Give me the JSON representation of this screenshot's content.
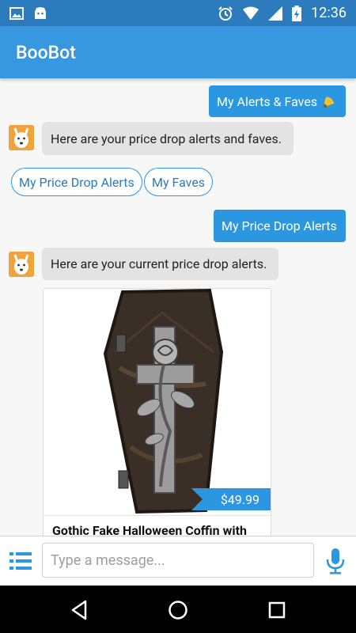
{
  "status_bar": {
    "time": "12:36",
    "left_icons": [
      "image-icon",
      "android-icon"
    ],
    "right_icons": [
      "alarm-icon",
      "wifi-icon",
      "signal-icon",
      "battery-icon"
    ]
  },
  "app_bar": {
    "title": "BooBot"
  },
  "chat": {
    "messages": [
      {
        "from": "user",
        "text": "My Alerts & Faves"
      },
      {
        "from": "bot",
        "text": "Here are your price drop alerts and faves."
      },
      {
        "from": "user",
        "text": "My Price Drop Alerts"
      },
      {
        "from": "bot",
        "text": "Here are your current price drop alerts."
      }
    ],
    "quick_replies": [
      "My Price Drop Alerts",
      "My Faves"
    ],
    "product_card": {
      "price": "$49.99",
      "title": "Gothic Fake Halloween Coffin with"
    }
  },
  "input_bar": {
    "placeholder": "Type a message..."
  },
  "colors": {
    "accent": "#3797df",
    "status_bar": "#2b7bbd",
    "avatar": "#f1a33b"
  }
}
